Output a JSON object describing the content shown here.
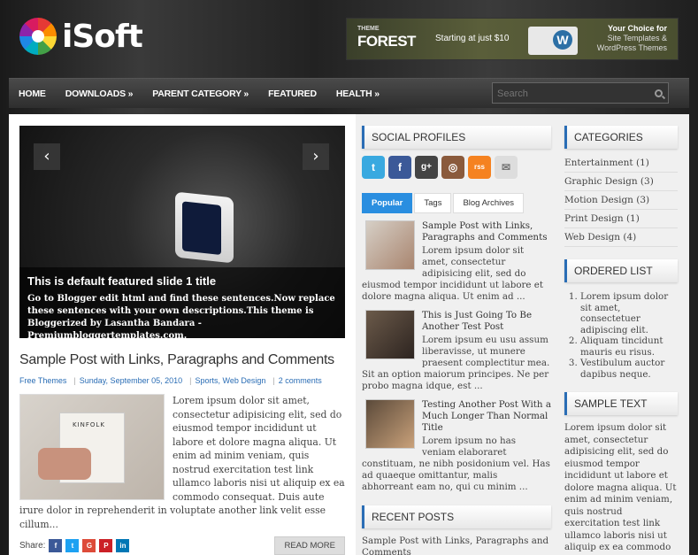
{
  "header": {
    "logo_text": "iSoft",
    "banner": {
      "brand_small": "THEME",
      "brand_big": "FOREST",
      "starting": "Starting at just $10",
      "choice_line1": "Your Choice for",
      "choice_line2": "Site Templates &",
      "choice_line3": "WordPress Themes"
    }
  },
  "nav": {
    "items": [
      "HOME",
      "DOWNLOADS »",
      "PARENT CATEGORY »",
      "FEATURED",
      "HEALTH »"
    ],
    "search_placeholder": "Search"
  },
  "slider": {
    "title": "This is default featured slide 1 title",
    "text": "Go to Blogger edit html and find these sentences.Now replace these sentences with your own descriptions.This theme is Bloggerized by Lasantha Bandara - Premiumbloggertemplates.com.",
    "prev": "‹",
    "next": "›"
  },
  "post": {
    "title": "Sample Post with Links, Paragraphs and Comments",
    "author": "Free Themes",
    "date": "Sunday, September 05, 2010",
    "labels": "Sports, Web Design",
    "comments": "2 comments",
    "thumb_text": "KINFOLK",
    "body": "Lorem ipsum dolor sit amet, consectetur adipisicing elit, sed do eiusmod tempor incididunt ut labore et dolore magna aliqua. Ut enim ad minim veniam, quis nostrud exercitation test link ullamco laboris nisi ut aliquip ex ea commodo consequat. Duis aute irure dolor in reprehenderit in voluptate another link velit esse cillum...",
    "share_label": "Share:",
    "read_more": "READ MORE"
  },
  "social": {
    "title": "SOCIAL PROFILES",
    "icons": [
      "t",
      "f",
      "g+",
      "◎",
      "rss",
      "✉"
    ]
  },
  "tabs": [
    "Popular",
    "Tags",
    "Blog Archives"
  ],
  "popular": [
    {
      "title": "Sample Post with Links, Paragraphs and Comments",
      "text": "Lorem ipsum dolor sit amet, consectetur adipisicing elit, sed do eiusmod tempor incididunt ut labore et dolore magna aliqua. Ut enim ad ..."
    },
    {
      "title": "This is Just Going To Be Another Test Post",
      "text": "Lorem ipsum eu usu assum liberavisse, ut munere praesent complectitur mea. Sit an option maiorum principes. Ne per probo magna idque, est ..."
    },
    {
      "title": "Testing Another Post With a Much Longer Than Normal Title",
      "text": "Lorem ipsum no has veniam elaboraret constituam, ne nibh posidonium vel. Has ad quaeque omittantur, malis abhorreant eam no, qui cu minim ..."
    }
  ],
  "recent": {
    "title": "RECENT POSTS",
    "first": "Sample Post with Links, Paragraphs and Comments"
  },
  "categories": {
    "title": "CATEGORIES",
    "items": [
      "Entertainment (1)",
      "Graphic Design (3)",
      "Motion Design (3)",
      "Print Design (1)",
      "Web Design (4)"
    ]
  },
  "ordered": {
    "title": "ORDERED LIST",
    "items": [
      "Lorem ipsum dolor sit amet, consectetuer adipiscing elit.",
      "Aliquam tincidunt mauris eu risus.",
      "Vestibulum auctor dapibus neque."
    ]
  },
  "sample": {
    "title": "SAMPLE TEXT",
    "text": "Lorem ipsum dolor sit amet, consectetur adipisicing elit, sed do eiusmod tempor incididunt ut labore et dolore magna aliqua. Ut enim ad minim veniam, quis nostrud exercitation test link ullamco laboris nisi ut aliquip ex ea commodo consequat."
  },
  "colors": {
    "accent": "#2a6db5",
    "tab_active": "#2a8ee0"
  }
}
